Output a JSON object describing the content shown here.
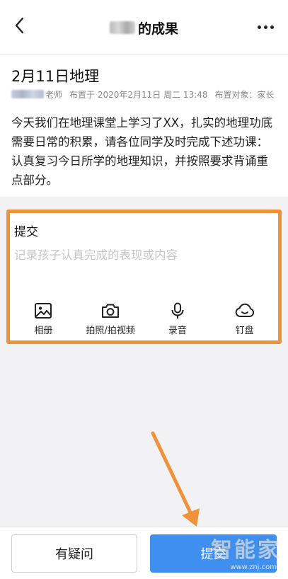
{
  "header": {
    "title": "的成果",
    "back_icon": "chevron-left-icon",
    "more_icon": "more-horizontal-icon"
  },
  "homework": {
    "title": "2月11日地理",
    "teacher_suffix": "老师",
    "posted_label": "布置于",
    "posted_time": "2020年2月11日 周二 13:48",
    "target_label": "布置对象：",
    "target_value": "家长",
    "description": "今天我们在地理课堂上学习了XX，扎实的地理功底需要日常的积累，请各位同学及时完成下述功课：认真复习今日所学的地理知识，并按照要求背诵重点部分。"
  },
  "submit_card": {
    "title": "提交",
    "placeholder": "记录孩子认真完成的表现或内容",
    "value": "",
    "highlight_color": "#f0923a",
    "tools": [
      {
        "icon": "image-icon",
        "label": "相册"
      },
      {
        "icon": "camera-icon",
        "label": "拍照/拍视频"
      },
      {
        "icon": "microphone-icon",
        "label": "录音"
      },
      {
        "icon": "cloud-icon",
        "label": "钉盘"
      }
    ]
  },
  "footer": {
    "question_button": "有疑问",
    "submit_button": "提交",
    "accent_color": "#3e8ff0"
  },
  "watermark": {
    "logo_text": "智能家",
    "url": "www.znj.com"
  }
}
